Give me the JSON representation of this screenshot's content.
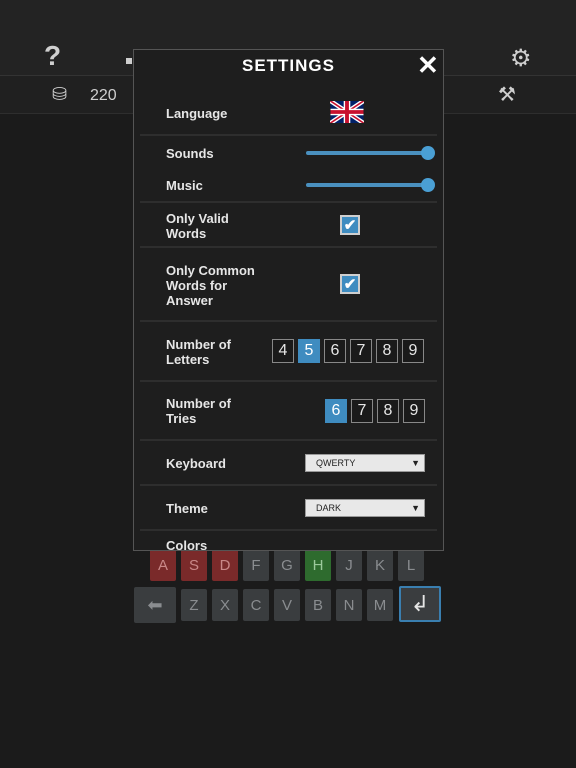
{
  "header": {
    "help_icon": "?",
    "coins": "220"
  },
  "settings": {
    "title": "SETTINGS",
    "close": "✕",
    "language_label": "Language",
    "sounds_label": "Sounds",
    "music_label": "Music",
    "sounds_level": 1.0,
    "music_level": 1.0,
    "only_valid_words_label": "Only Valid Words",
    "only_valid_words_checked": true,
    "only_common_label": "Only Common Words for Answer",
    "only_common_checked": true,
    "letters_label": "Number of Letters",
    "letters_options": [
      "4",
      "5",
      "6",
      "7",
      "8",
      "9"
    ],
    "letters_selected": "5",
    "tries_label": "Number of Tries",
    "tries_options": [
      "6",
      "7",
      "8",
      "9"
    ],
    "tries_selected": "6",
    "keyboard_label": "Keyboard",
    "keyboard_value": "QWERTY",
    "theme_label": "Theme",
    "theme_value": "DARK",
    "colors_label": "Colors",
    "check_glyph": "✔"
  },
  "keyboard": {
    "row2": [
      "A",
      "S",
      "D",
      "F",
      "G",
      "H",
      "J",
      "K",
      "L"
    ],
    "row3": [
      "Z",
      "X",
      "C",
      "V",
      "B",
      "N",
      "M"
    ],
    "backspace": "⬅",
    "enter": "↲"
  },
  "colors": {
    "accent": "#3f8cc0",
    "key_red": "#7a2a2a",
    "key_green": "#2e6b2e"
  }
}
